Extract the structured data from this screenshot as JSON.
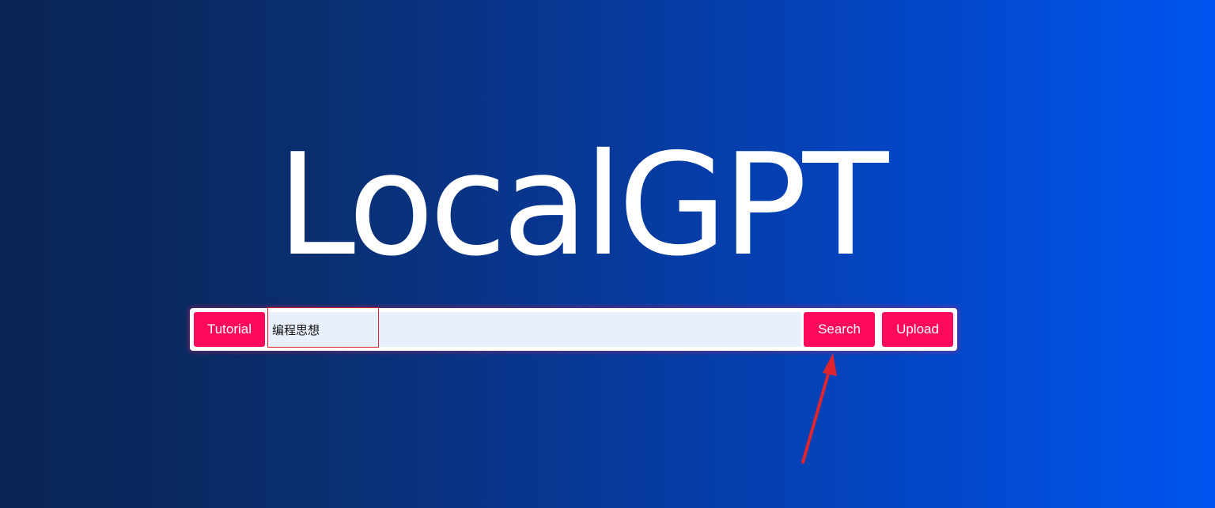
{
  "app": {
    "title": "LocalGPT"
  },
  "search_bar": {
    "tutorial_label": "Tutorial",
    "query_value": "编程思想",
    "search_label": "Search",
    "upload_label": "Upload"
  },
  "colors": {
    "accent_button": "#ff0a5a",
    "input_background": "#e8f0fe",
    "annotation_red": "#e0242e",
    "background_start": "#0a2352",
    "background_end": "#0055f0"
  },
  "annotations": {
    "input_highlight": "red-rectangle",
    "search_pointer": "red-arrow-icon"
  }
}
